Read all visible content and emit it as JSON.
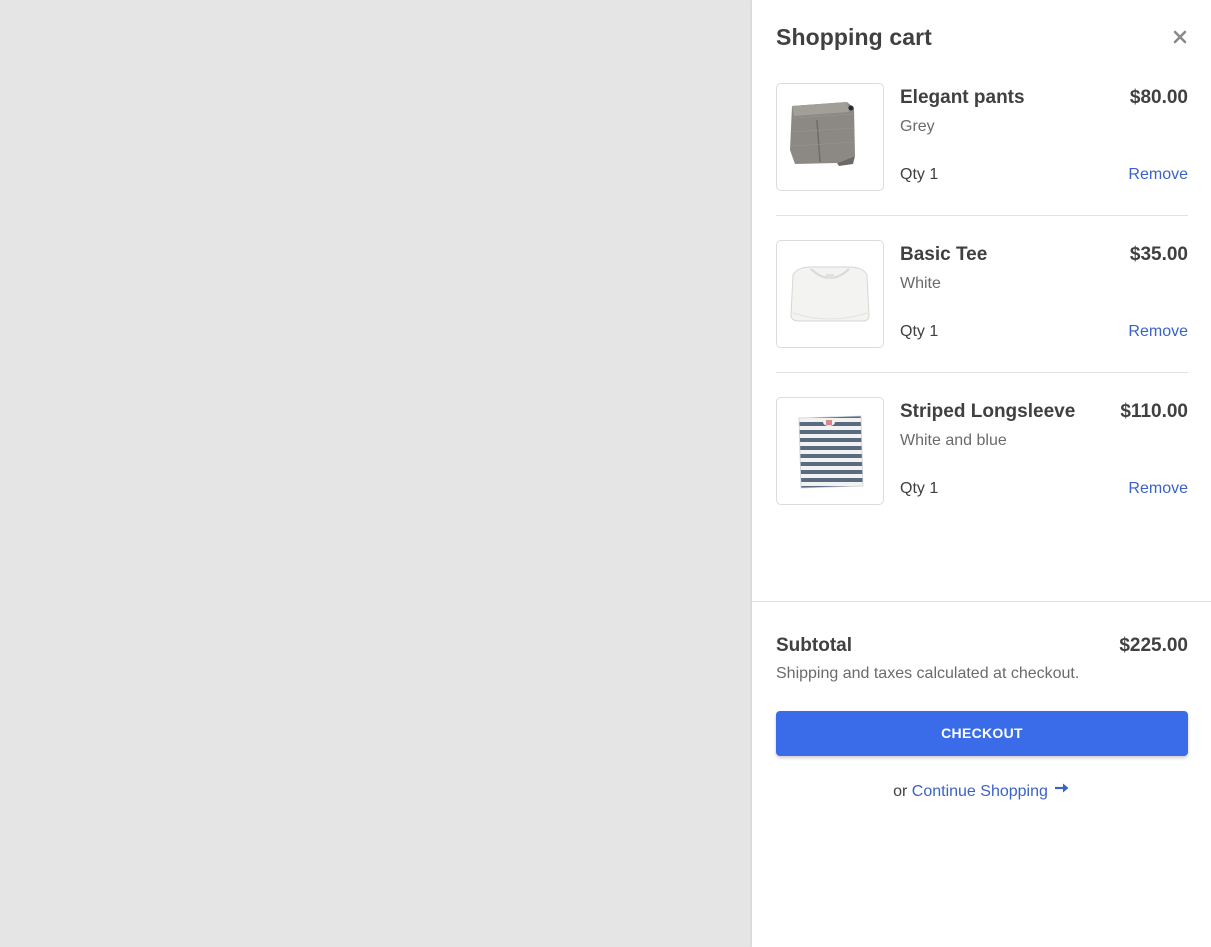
{
  "cart": {
    "title": "Shopping cart",
    "close_icon": "close-icon",
    "items": [
      {
        "name": "Elegant pants",
        "variant": "Grey",
        "quantity": "Qty 1",
        "price": "$80.00",
        "remove_label": "Remove",
        "image_icon": "grey-pants-image"
      },
      {
        "name": "Basic Tee",
        "variant": "White",
        "quantity": "Qty 1",
        "price": "$35.00",
        "remove_label": "Remove",
        "image_icon": "white-tee-image"
      },
      {
        "name": "Striped Longsleeve",
        "variant": "White and blue",
        "quantity": "Qty 1",
        "price": "$110.00",
        "remove_label": "Remove",
        "image_icon": "striped-longsleeve-image"
      }
    ]
  },
  "summary": {
    "subtotal_label": "Subtotal",
    "subtotal_value": "$225.00",
    "shipping_note": "Shipping and taxes calculated at checkout.",
    "checkout_label": "CHECKOUT",
    "or_label": "or",
    "continue_label": "Continue Shopping",
    "continue_icon": "arrow-right-icon"
  },
  "colors": {
    "accent": "#3a6be8",
    "link": "#3a62c7",
    "overlay": "#e5e5e5",
    "text": "#404040",
    "muted_text": "#6b6b6b"
  }
}
